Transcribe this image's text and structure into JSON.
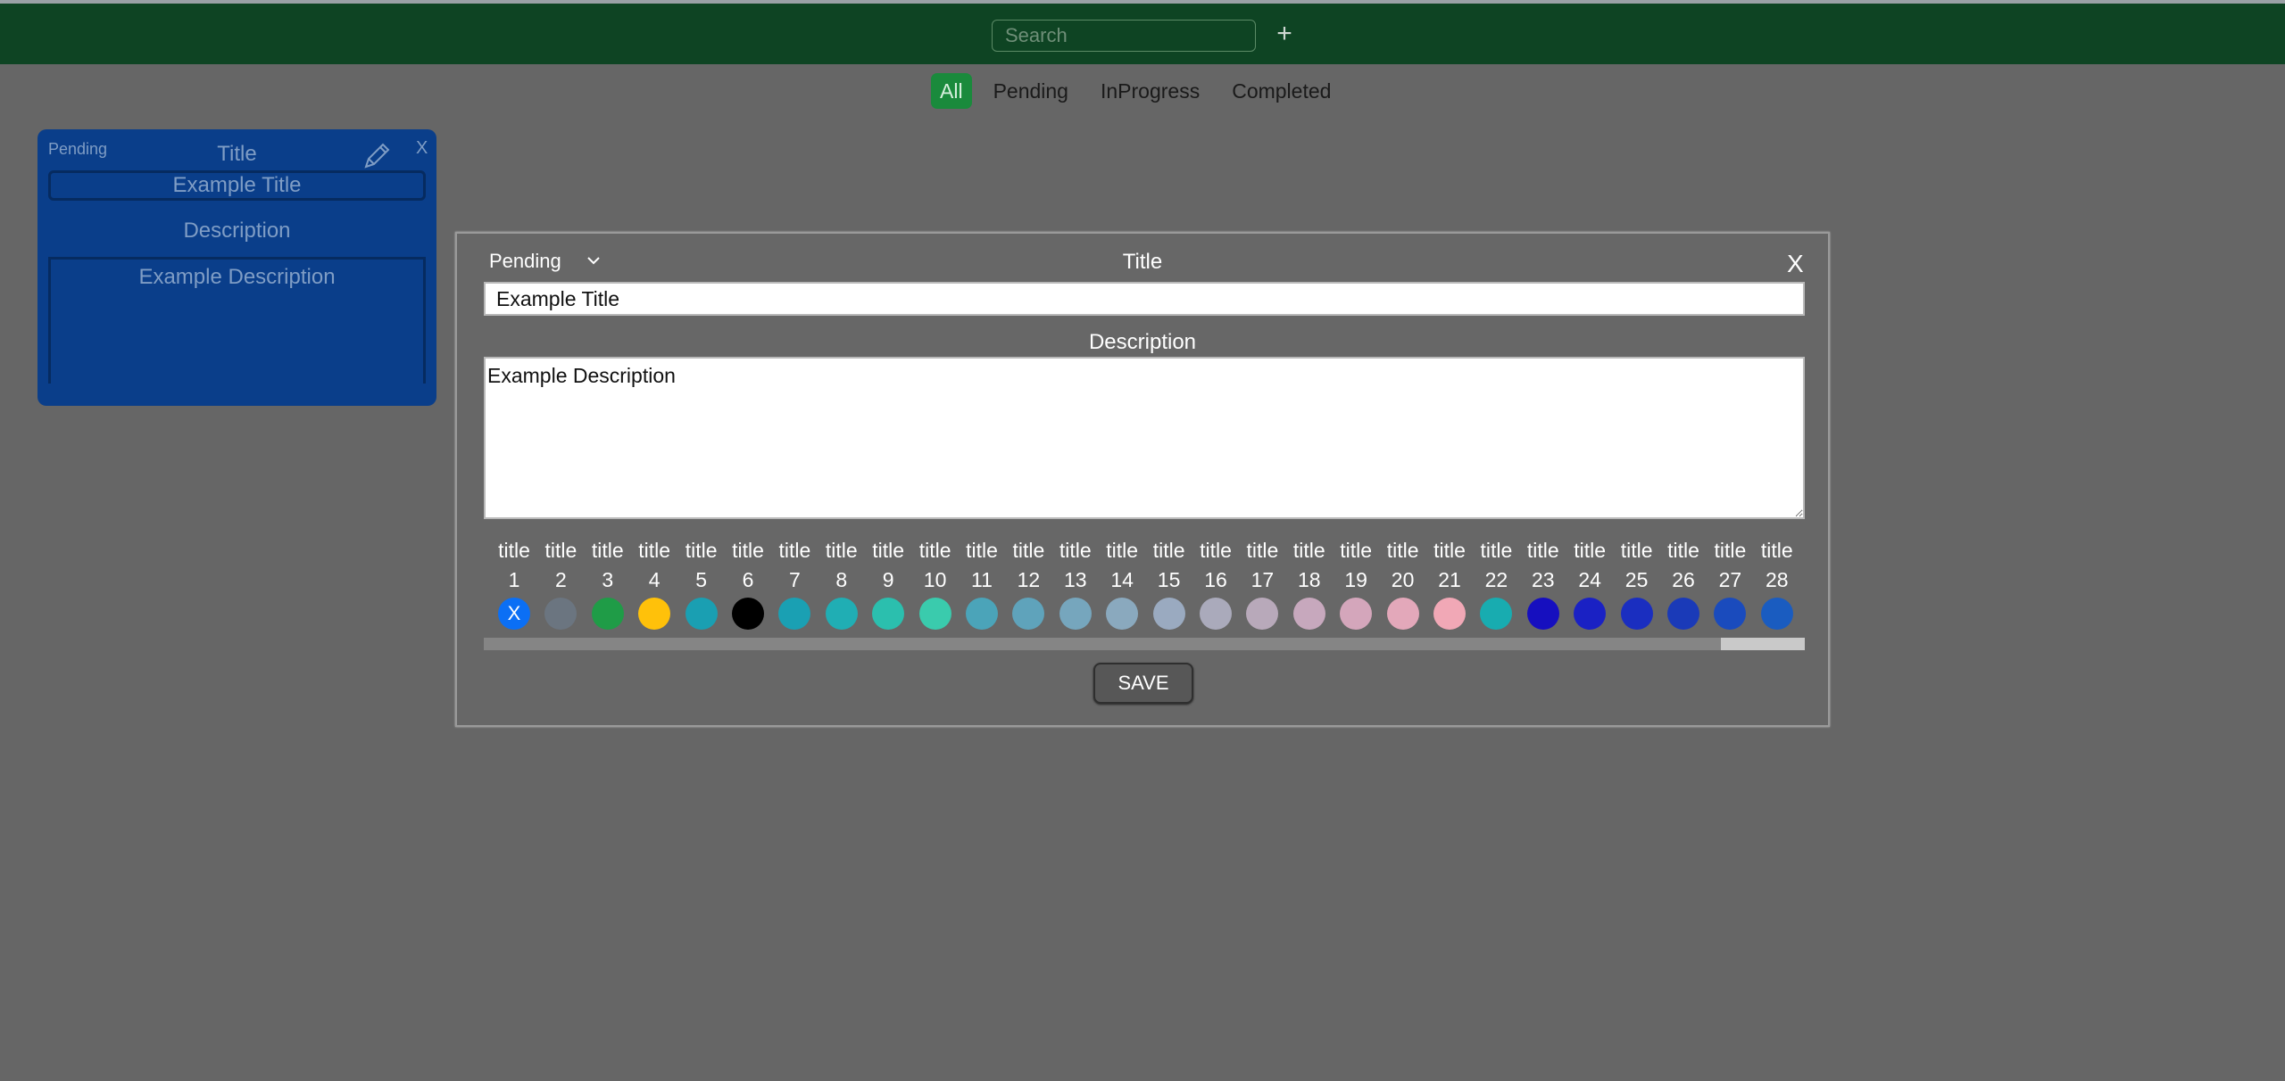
{
  "header": {
    "search_placeholder": "Search",
    "add_label": "+"
  },
  "filters": [
    {
      "label": "All",
      "active": true
    },
    {
      "label": "Pending",
      "active": false
    },
    {
      "label": "InProgress",
      "active": false
    },
    {
      "label": "Completed",
      "active": false
    }
  ],
  "card": {
    "status": "Pending",
    "title_label": "Title",
    "title_value": "Example Title",
    "description_label": "Description",
    "description_value": "Example Description",
    "close_label": "X",
    "color": "#0a3e8a"
  },
  "modal": {
    "status": "Pending",
    "title_label": "Title",
    "title_value": "Example Title",
    "description_label": "Description",
    "description_value": "Example Description",
    "close_label": "X",
    "save_label": "SAVE",
    "selected_mark": "X",
    "colors": [
      {
        "title": "title",
        "num": "1",
        "color": "#0b6ff5"
      },
      {
        "title": "title",
        "num": "2",
        "color": "#6b7580"
      },
      {
        "title": "title",
        "num": "3",
        "color": "#1f9c47"
      },
      {
        "title": "title",
        "num": "4",
        "color": "#ffc10a"
      },
      {
        "title": "title",
        "num": "5",
        "color": "#1a9fb2"
      },
      {
        "title": "title",
        "num": "6",
        "color": "#000000"
      },
      {
        "title": "title",
        "num": "7",
        "color": "#1aa0b3"
      },
      {
        "title": "title",
        "num": "8",
        "color": "#20aeb4"
      },
      {
        "title": "title",
        "num": "9",
        "color": "#2bbfae"
      },
      {
        "title": "title",
        "num": "10",
        "color": "#3acbad"
      },
      {
        "title": "title",
        "num": "11",
        "color": "#4ba4b9"
      },
      {
        "title": "title",
        "num": "12",
        "color": "#5fa3bb"
      },
      {
        "title": "title",
        "num": "13",
        "color": "#76a6bd"
      },
      {
        "title": "title",
        "num": "14",
        "color": "#8aa9be"
      },
      {
        "title": "title",
        "num": "15",
        "color": "#9aaac0"
      },
      {
        "title": "title",
        "num": "16",
        "color": "#aaaabb"
      },
      {
        "title": "title",
        "num": "17",
        "color": "#b8a9ba"
      },
      {
        "title": "title",
        "num": "18",
        "color": "#c7a8bd"
      },
      {
        "title": "title",
        "num": "19",
        "color": "#d4a6bb"
      },
      {
        "title": "title",
        "num": "20",
        "color": "#e3a8ba"
      },
      {
        "title": "title",
        "num": "21",
        "color": "#f1a8b6"
      },
      {
        "title": "title",
        "num": "22",
        "color": "#18acb0"
      },
      {
        "title": "title",
        "num": "23",
        "color": "#160fbf"
      },
      {
        "title": "title",
        "num": "24",
        "color": "#1a21c4"
      },
      {
        "title": "title",
        "num": "25",
        "color": "#1a2ec0"
      },
      {
        "title": "title",
        "num": "26",
        "color": "#1a3ab8"
      },
      {
        "title": "title",
        "num": "27",
        "color": "#1a4bbd"
      },
      {
        "title": "title",
        "num": "28",
        "color": "#1a5cc0"
      }
    ]
  }
}
